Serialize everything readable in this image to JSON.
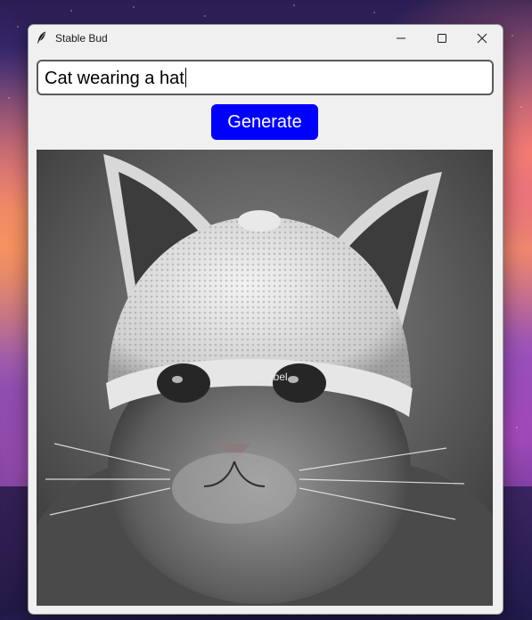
{
  "window": {
    "title": "Stable Bud",
    "app_icon": "feather-icon",
    "controls": {
      "minimize_icon": "minimize-icon",
      "maximize_icon": "maximize-icon",
      "close_icon": "close-icon"
    }
  },
  "prompt": {
    "value": "Cat wearing a hat"
  },
  "generate_button": {
    "label": "Generate",
    "color": "#0000ff",
    "text_color": "#ffffff"
  },
  "image": {
    "overlay_label": "CTkLabel",
    "description": "generated-image"
  }
}
